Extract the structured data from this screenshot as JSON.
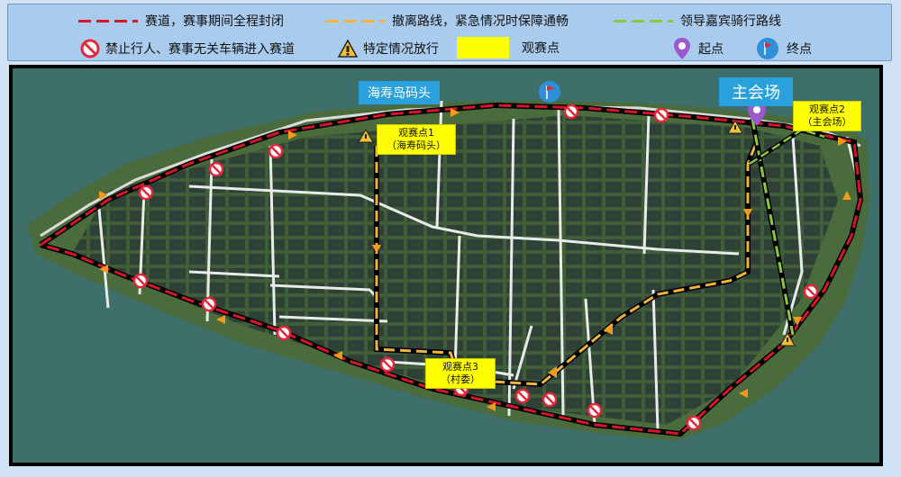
{
  "legend": {
    "race_route": "赛道，赛事期间全程封闭",
    "evac_route": "撤离路线，紧急情况时保障通畅",
    "vip_route": "领导嘉宾骑行路线",
    "no_entry": "禁止行人、赛事无关车辆进入赛道",
    "special_pass": "特定情况放行",
    "spectator": "观赛点",
    "start": "起点",
    "finish": "终点"
  },
  "map_labels": {
    "dock": "海寿岛码头",
    "main_venue": "主会场",
    "spot1_line1": "观赛点1",
    "spot1_line2": "（海寿码头）",
    "spot2_line1": "观赛点2",
    "spot2_line2": "（主会场）",
    "spot3_line1": "观赛点3",
    "spot3_line2": "（村委）"
  },
  "colors": {
    "race_red": "#d8142a",
    "evac_orange": "#f2b33a",
    "vip_green": "#8dc63f",
    "spectator_yellow": "#ffff00",
    "label_blue": "#2aa0dc"
  },
  "icons": [
    "no-entry-icon",
    "warning-icon",
    "start-pin-icon",
    "finish-flag-icon",
    "direction-arrow-icon"
  ]
}
